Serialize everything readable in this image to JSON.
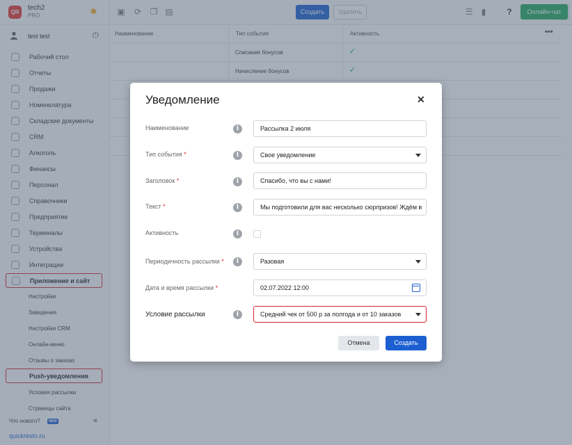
{
  "brand": {
    "logo": "QR",
    "name": "tech2",
    "plan": "PRO",
    "theme_icon": "sun-icon"
  },
  "user": {
    "name": "test test"
  },
  "sidebar": {
    "items": [
      {
        "label": "Рабочий стол"
      },
      {
        "label": "Отчеты"
      },
      {
        "label": "Продажи"
      },
      {
        "label": "Номенклатура"
      },
      {
        "label": "Складские документы"
      },
      {
        "label": "CRM"
      },
      {
        "label": "Алкоголь"
      },
      {
        "label": "Финансы"
      },
      {
        "label": "Персонал"
      },
      {
        "label": "Справочники"
      },
      {
        "label": "Предприятие"
      },
      {
        "label": "Терминалы"
      },
      {
        "label": "Устройства"
      },
      {
        "label": "Интеграции"
      },
      {
        "label": "Приложение и сайт"
      }
    ],
    "subitems": [
      {
        "label": "Настройки"
      },
      {
        "label": "Заведения"
      },
      {
        "label": "Настройки CRM"
      },
      {
        "label": "Онлайн-меню"
      },
      {
        "label": "Отзывы о заказах"
      },
      {
        "label": "Push-уведомления"
      },
      {
        "label": "Условия рассылки"
      },
      {
        "label": "Страницы сайта"
      }
    ],
    "whats_new": "Что нового?",
    "new_badge": "NEW",
    "site_link": "quickresto.ru"
  },
  "toolbar": {
    "create_label": "Создать",
    "delete_label": "Удалить",
    "chat_label": "Онлайн-чат"
  },
  "table": {
    "headers": [
      "Наименование",
      "Тип события",
      "Активность"
    ],
    "rows": [
      {
        "name": "",
        "event": "Списание бонусов",
        "active": "✓"
      },
      {
        "name": "",
        "event": "Начисление бонусов",
        "active": "✓"
      }
    ]
  },
  "modal": {
    "title": "Уведомление",
    "fields": {
      "name": {
        "label": "Наименование",
        "value": "Рассылка 2 июля"
      },
      "event_type": {
        "label": "Тип события",
        "value": "Свое уведомление"
      },
      "heading": {
        "label": "Заголовок",
        "value": "Спасибо, что вы с нами!"
      },
      "text": {
        "label": "Текст",
        "value": "Мы подготовили для вас несколько сюрпризов! Ждём в"
      },
      "active": {
        "label": "Активность"
      },
      "frequency": {
        "label": "Периодичность рассылки",
        "value": "Разовая"
      },
      "datetime": {
        "label": "Дата и время рассылки",
        "value": "02.07.2022 12:00"
      },
      "condition": {
        "label": "Условие рассылки",
        "value": "Средний чек от 500 р за полгода и от 10 заказов"
      }
    },
    "required_mark": "*",
    "info_glyph": "i",
    "cancel_label": "Отмена",
    "submit_label": "Создать"
  },
  "colors": {
    "primary": "#1b5fd1",
    "success": "#1fa85a",
    "danger": "#d9242f"
  }
}
